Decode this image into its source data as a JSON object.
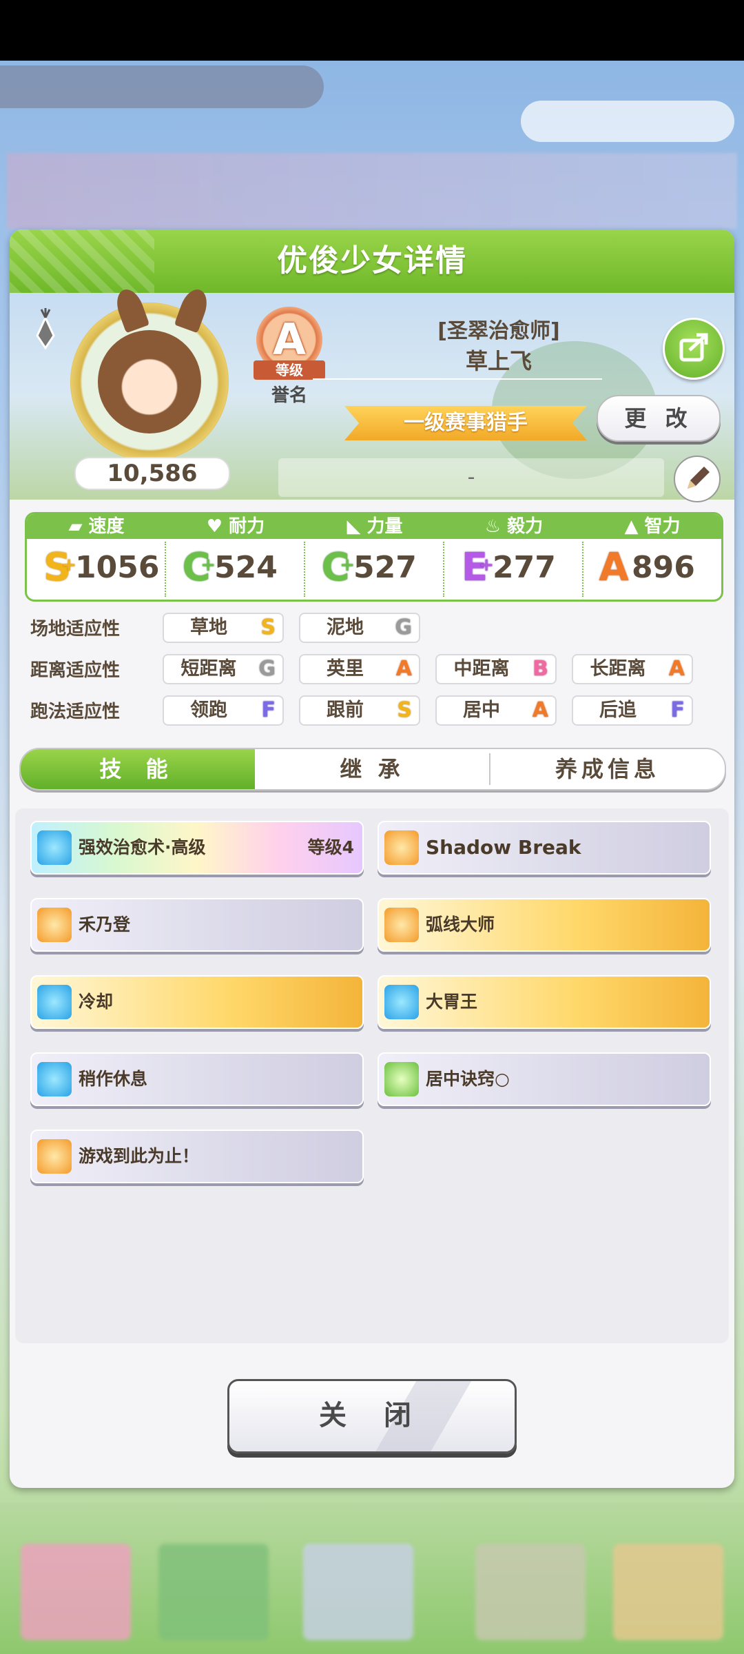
{
  "panel": {
    "title": "优俊少女详情"
  },
  "profile": {
    "fans": "10,586",
    "rank_grade": "A",
    "rank_ribbon": "等级",
    "rank_label": "誉名",
    "title_sub": "[圣翠治愈师]",
    "title_main": "草上飞",
    "epithet": "一级赛事猎手",
    "change_label": "更 改",
    "memo": "-"
  },
  "stats": [
    {
      "label": "速度",
      "grade": "S",
      "plus": "+",
      "value": "1056",
      "icon": "speed-shoe-icon"
    },
    {
      "label": "耐力",
      "grade": "C",
      "plus": "+",
      "value": "524",
      "icon": "heart-icon"
    },
    {
      "label": "力量",
      "grade": "C",
      "plus": "+",
      "value": "527",
      "icon": "muscle-arm-icon"
    },
    {
      "label": "毅力",
      "grade": "E",
      "plus": "+",
      "value": "277",
      "icon": "flame-icon"
    },
    {
      "label": "智力",
      "grade": "A",
      "plus": "",
      "value": "896",
      "icon": "graduation-cap-icon"
    }
  ],
  "aptitudes": {
    "track": {
      "label": "场地适应性",
      "items": [
        {
          "name": "草地",
          "grade": "S"
        },
        {
          "name": "泥地",
          "grade": "G"
        }
      ]
    },
    "distance": {
      "label": "距离适应性",
      "items": [
        {
          "name": "短距离",
          "grade": "G"
        },
        {
          "name": "英里",
          "grade": "A"
        },
        {
          "name": "中距离",
          "grade": "B"
        },
        {
          "name": "长距离",
          "grade": "A"
        }
      ]
    },
    "style": {
      "label": "跑法适应性",
      "items": [
        {
          "name": "领跑",
          "grade": "F"
        },
        {
          "name": "跟前",
          "grade": "S"
        },
        {
          "name": "居中",
          "grade": "A"
        },
        {
          "name": "后追",
          "grade": "F"
        }
      ]
    }
  },
  "tabs": [
    {
      "label": "技 能",
      "active": true
    },
    {
      "label": "继 承",
      "active": false
    },
    {
      "label": "养成信息",
      "active": false
    }
  ],
  "skills": [
    {
      "name": "强效治愈术·高级",
      "level": "等级4",
      "style": "rainbow",
      "icon": "blue-sparkle-icon"
    },
    {
      "name": "Shadow Break",
      "level": "",
      "style": "plain",
      "icon": "orange-horse-icon"
    },
    {
      "name": "禾乃登",
      "level": "",
      "style": "plain",
      "icon": "orange-horse-icon"
    },
    {
      "name": "弧线大师",
      "level": "",
      "style": "gold",
      "icon": "orange-horse-icon"
    },
    {
      "name": "冷却",
      "level": "",
      "style": "gold",
      "icon": "blue-sparkle-icon"
    },
    {
      "name": "大胃王",
      "level": "",
      "style": "gold",
      "icon": "blue-sparkle-icon"
    },
    {
      "name": "稍作休息",
      "level": "",
      "style": "plain",
      "icon": "blue-sparkle-icon"
    },
    {
      "name": "居中诀窍○",
      "level": "",
      "style": "plain",
      "icon": "green-book-icon"
    },
    {
      "name": "游戏到此为止！",
      "level": "",
      "style": "plain",
      "icon": "orange-horse-icon"
    }
  ],
  "close_label": "关 闭",
  "colors": {
    "header_green": "#6fb82a",
    "accent_orange": "#f2a928",
    "grade_S": "#f1b41a",
    "grade_A": "#f07a2a"
  }
}
